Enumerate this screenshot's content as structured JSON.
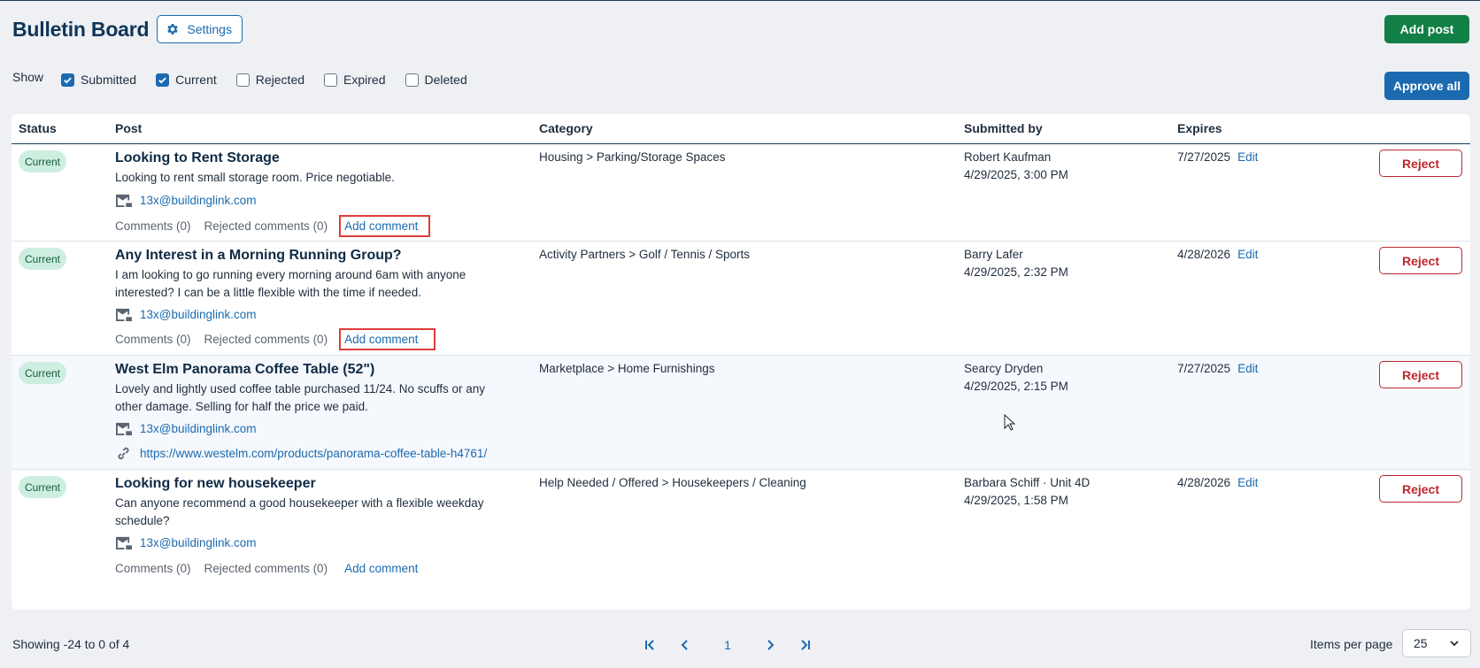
{
  "header": {
    "title": "Bulletin Board",
    "settings_label": "Settings",
    "add_post_label": "Add post",
    "approve_all_label": "Approve all"
  },
  "filters": {
    "show_label": "Show",
    "options": [
      {
        "label": "Submitted",
        "checked": true
      },
      {
        "label": "Current",
        "checked": true
      },
      {
        "label": "Rejected",
        "checked": false
      },
      {
        "label": "Expired",
        "checked": false
      },
      {
        "label": "Deleted",
        "checked": false
      }
    ]
  },
  "table": {
    "columns": [
      "Status",
      "Post",
      "Category",
      "Submitted by",
      "Expires"
    ],
    "rows": [
      {
        "status": "Current",
        "title": "Looking to Rent Storage",
        "body": "Looking to rent small storage room. Price negotiable.",
        "email": "13x@buildinglink.com",
        "link": "",
        "comments": "Comments (0)",
        "rejected_comments": "Rejected comments (0)",
        "add_comment": "Add comment",
        "category": "Housing > Parking/Storage Spaces",
        "submitted_by": "Robert Kaufman",
        "submitted_at": "4/29/2025, 3:00 PM",
        "expires": "7/27/2025",
        "edit": "Edit",
        "reject": "Reject"
      },
      {
        "status": "Current",
        "title": "Any Interest in a Morning Running Group?",
        "body": "I am looking to go running every morning around 6am with anyone interested? I can be a little flexible with the time if needed.",
        "email": "13x@buildinglink.com",
        "link": "",
        "comments": "Comments (0)",
        "rejected_comments": "Rejected comments (0)",
        "add_comment": "Add comment",
        "category": "Activity Partners > Golf / Tennis / Sports",
        "submitted_by": "Barry Lafer",
        "submitted_at": "4/29/2025, 2:32 PM",
        "expires": "4/28/2026",
        "edit": "Edit",
        "reject": "Reject"
      },
      {
        "status": "Current",
        "title": "West Elm Panorama Coffee Table (52\")",
        "body": "Lovely and lightly used coffee table purchased 11/24. No scuffs or any other damage. Selling for half the price we paid.",
        "email": "13x@buildinglink.com",
        "link": "https://www.westelm.com/products/panorama-coffee-table-h4761/",
        "comments": "",
        "rejected_comments": "",
        "add_comment": "",
        "category": "Marketplace > Home Furnishings",
        "submitted_by": "Searcy Dryden",
        "submitted_at": "4/29/2025, 2:15 PM",
        "expires": "7/27/2025",
        "edit": "Edit",
        "reject": "Reject"
      },
      {
        "status": "Current",
        "title": "Looking for new housekeeper",
        "body": "Can anyone recommend a good housekeeper with a flexible weekday schedule?",
        "email": "13x@buildinglink.com",
        "link": "",
        "comments": "Comments (0)",
        "rejected_comments": "Rejected comments (0)",
        "add_comment": "Add comment",
        "category": "Help Needed / Offered > Housekeepers / Cleaning",
        "submitted_by": "Barbara Schiff · Unit 4D",
        "submitted_at": "4/29/2025, 1:58 PM",
        "expires": "4/28/2026",
        "edit": "Edit",
        "reject": "Reject"
      }
    ]
  },
  "footer": {
    "showing": "Showing -24 to 0 of 4",
    "current_page": "1",
    "items_per_page_label": "Items per page",
    "items_per_page_value": "25"
  },
  "colors": {
    "primary": "#1b6ab0",
    "success": "#128046",
    "danger": "#c0262d",
    "badge_bg": "#cdeee0",
    "highlight_box": "#e03b3b"
  }
}
